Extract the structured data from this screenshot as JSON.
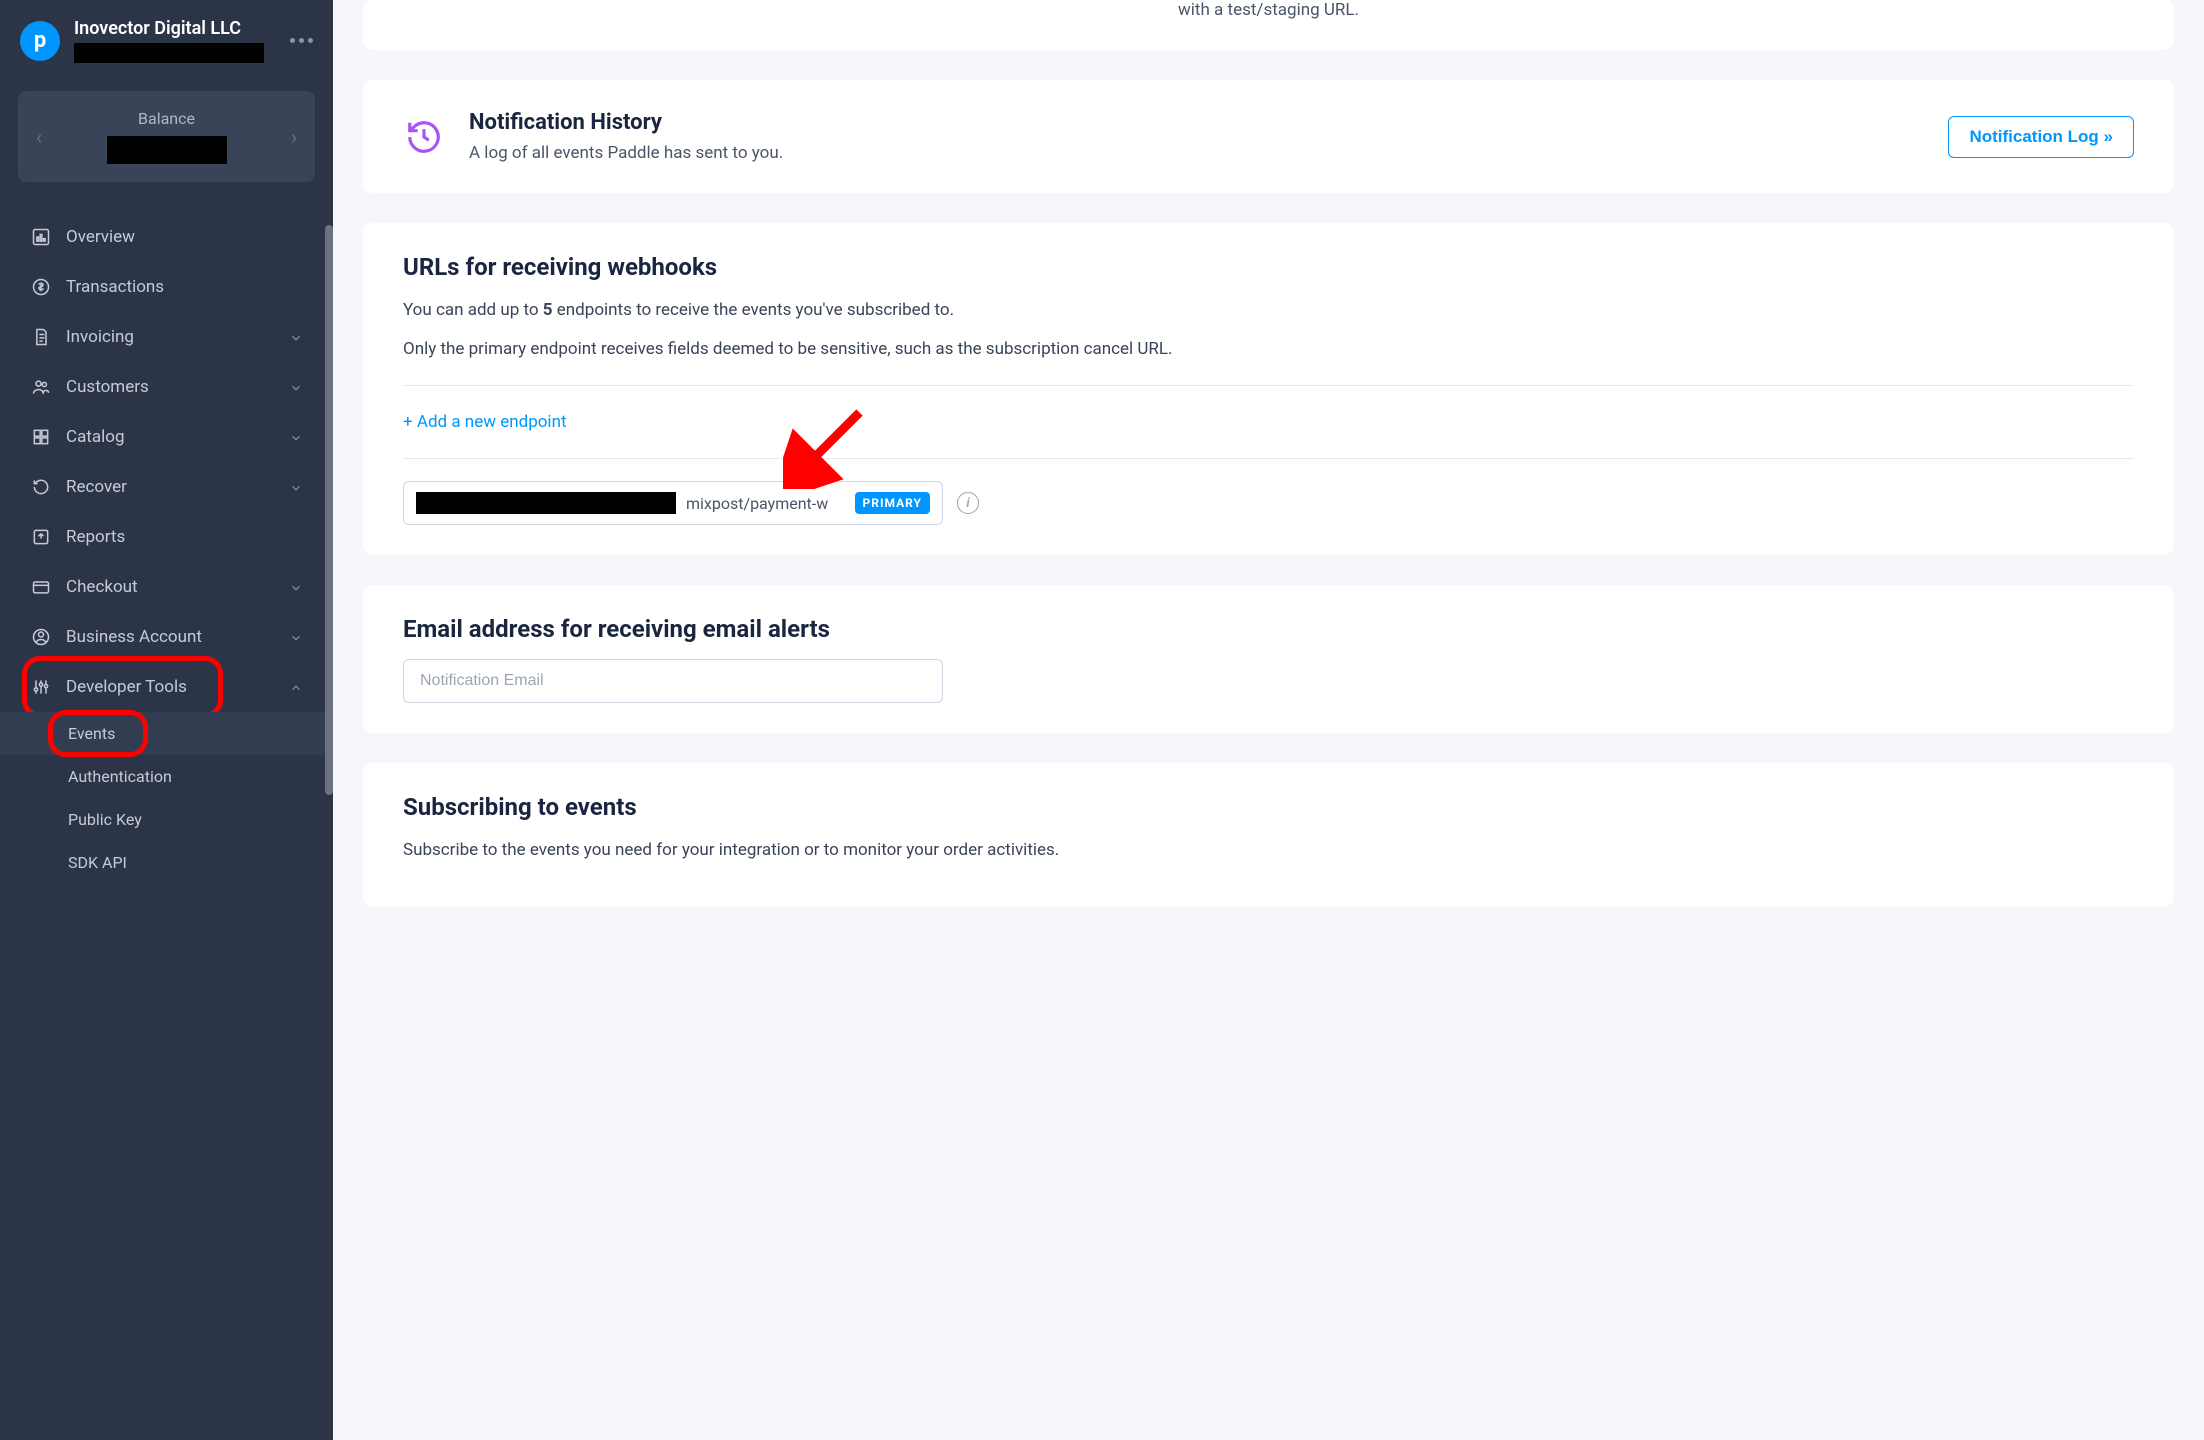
{
  "company": {
    "name": "Inovector Digital LLC"
  },
  "balance": {
    "label": "Balance"
  },
  "sidebar": {
    "items": [
      {
        "label": "Overview",
        "icon": "dashboard",
        "expandable": false
      },
      {
        "label": "Transactions",
        "icon": "dollar",
        "expandable": false
      },
      {
        "label": "Invoicing",
        "icon": "invoice",
        "expandable": true
      },
      {
        "label": "Customers",
        "icon": "users",
        "expandable": true
      },
      {
        "label": "Catalog",
        "icon": "grid",
        "expandable": true
      },
      {
        "label": "Recover",
        "icon": "undo",
        "expandable": true
      },
      {
        "label": "Reports",
        "icon": "export",
        "expandable": false
      },
      {
        "label": "Checkout",
        "icon": "card",
        "expandable": true
      },
      {
        "label": "Business Account",
        "icon": "person",
        "expandable": true
      },
      {
        "label": "Developer Tools",
        "icon": "sliders",
        "expandable": true
      }
    ],
    "devtools_sub": [
      {
        "label": "Events",
        "active": true
      },
      {
        "label": "Authentication",
        "active": false
      },
      {
        "label": "Public Key",
        "active": false
      },
      {
        "label": "SDK API",
        "active": false
      }
    ]
  },
  "main": {
    "partial_text": "with a test/staging URL.",
    "notification": {
      "title": "Notification History",
      "desc": "A log of all events Paddle has sent to you.",
      "button": "Notification Log »"
    },
    "webhooks": {
      "title": "URLs for receiving webhooks",
      "desc_pre": "You can add up to ",
      "desc_bold": "5",
      "desc_post": " endpoints to receive the events you've subscribed to.",
      "desc2": "Only the primary endpoint receives fields deemed to be sensitive, such as the subscription cancel URL.",
      "add_link": "+ Add a new endpoint",
      "endpoint_visible": "mixpost/payment-w",
      "primary_badge": "PRIMARY"
    },
    "email_alerts": {
      "title": "Email address for receiving email alerts",
      "placeholder": "Notification Email"
    },
    "subscribe": {
      "title": "Subscribing to events",
      "desc": "Subscribe to the events you need for your integration or to monitor your order activities."
    }
  }
}
